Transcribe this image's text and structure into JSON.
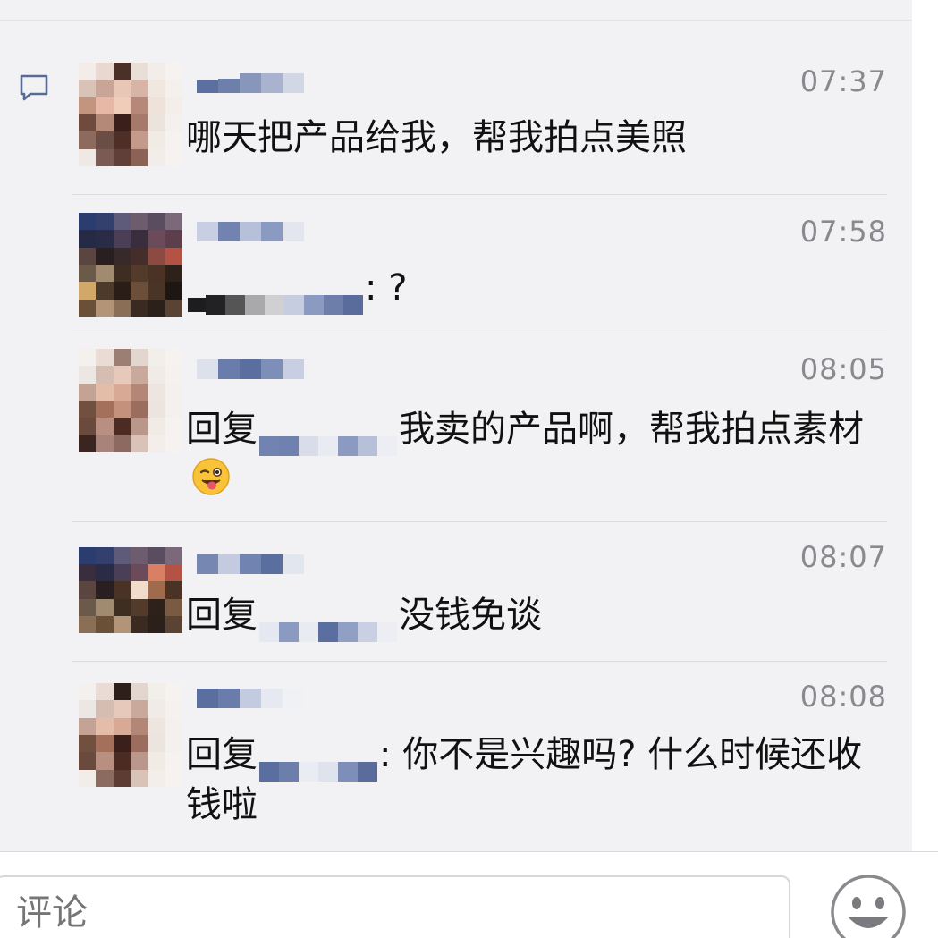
{
  "comments": [
    {
      "time": "07:37",
      "text": "哪天把产品给我，帮我拍点美照",
      "has_reply": false,
      "name_blur": "云"
    },
    {
      "time": "07:58",
      "text": ": ?",
      "has_reply": false,
      "name_blur": "i"
    },
    {
      "time": "08:05",
      "reply_prefix": "回复",
      "text": "我卖的产品啊，帮我拍点素材",
      "has_reply": true
    },
    {
      "time": "08:07",
      "reply_prefix": "回复",
      "text": "没钱免谈",
      "has_reply": true
    },
    {
      "time": "08:08",
      "reply_prefix": "回复",
      "text": ": 你不是兴趣吗? 什么时候还收钱啦",
      "has_reply": true
    }
  ],
  "input": {
    "placeholder": "评论"
  },
  "icons": {
    "comment": "comment-bubble-icon",
    "emoji": "smiley-face-icon",
    "wink": "wink-tongue-emoji"
  },
  "colors": {
    "panel_bg": "#f2f2f5",
    "time_gray": "#8a8a8e",
    "name_blue": "#576b95"
  }
}
